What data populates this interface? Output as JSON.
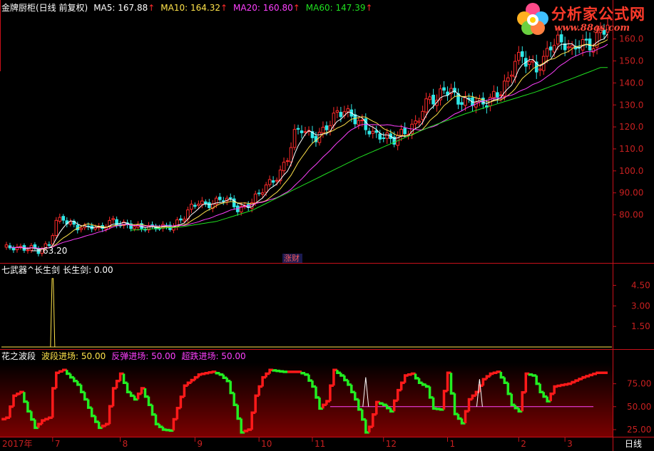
{
  "header1": {
    "title": "金牌厨柜(日线 前复权)",
    "ma5": "MA5: 167.88",
    "ma10": "MA10: 164.32",
    "ma20": "MA20: 160.80",
    "ma60": "MA60: 147.39",
    "arrow": "↑"
  },
  "header2": {
    "title": "七武器^长生剑",
    "value": "长生剑: 0.00"
  },
  "header3": {
    "title": "花之波段",
    "l1": "波段进场: 50.00",
    "l2": "反弹进场: 50.00",
    "l3": "超跌进场: 50.00"
  },
  "logo": {
    "name": "分析家公式网",
    "url": "www.88gs.com"
  },
  "annotations": {
    "low": "63.20",
    "event": "涨财"
  },
  "colors": {
    "up": "#ff2b2b",
    "down": "#2fe8e8",
    "ma5": "#ffffff",
    "ma10": "#ffe34a",
    "ma20": "#ff40ff",
    "ma60": "#20e020",
    "frame": "#c8101a",
    "green_seg": "#22ee22",
    "red_seg": "#ff1a1a",
    "white_line": "#ffffff",
    "magenta_line": "#ff44ff"
  },
  "bottom": {
    "year_label": "2017年",
    "months": [
      "7",
      "8",
      "9",
      "10",
      "11",
      "12",
      "1",
      "2",
      "3"
    ],
    "period": "日线"
  },
  "chart_data": [
    {
      "type": "candlestick",
      "title": "金牌厨柜(日线 前复权)",
      "y_ticks": [
        80.0,
        90.0,
        100.0,
        110.0,
        120.0,
        130.0,
        140.0,
        150.0,
        160.0
      ],
      "y_tick_labels": [
        "80.00",
        "90.00",
        "100.0",
        "110.0",
        "120.0",
        "130.0",
        "140.0",
        "150.0",
        "160.0"
      ],
      "ylim": [
        63,
        168
      ],
      "x_months": [
        "7",
        "8",
        "9",
        "10",
        "11",
        "12",
        "1",
        "2",
        "3"
      ],
      "close_path": [
        [
          0,
          65
        ],
        [
          4,
          64.5
        ],
        [
          8,
          65.5
        ],
        [
          10,
          63.5
        ],
        [
          13,
          66
        ],
        [
          15,
          77
        ],
        [
          17,
          79
        ],
        [
          19,
          76
        ],
        [
          21,
          74
        ],
        [
          23,
          73.5
        ],
        [
          25,
          75
        ],
        [
          27,
          74
        ],
        [
          29,
          76
        ],
        [
          31,
          77
        ],
        [
          33,
          75
        ],
        [
          36,
          75.5
        ],
        [
          39,
          74.5
        ],
        [
          42,
          73.8
        ],
        [
          45,
          74.5
        ],
        [
          48,
          75.5
        ],
        [
          51,
          79
        ],
        [
          53,
          83
        ],
        [
          55,
          86
        ],
        [
          57,
          85
        ],
        [
          60,
          86
        ],
        [
          62,
          87
        ],
        [
          64,
          86
        ],
        [
          66,
          83
        ],
        [
          68,
          84
        ],
        [
          70,
          86
        ],
        [
          72,
          89
        ],
        [
          74,
          93
        ],
        [
          76,
          96
        ],
        [
          78,
          100
        ],
        [
          80,
          106
        ],
        [
          82,
          116
        ],
        [
          84,
          119
        ],
        [
          86,
          117
        ],
        [
          88,
          116
        ],
        [
          90,
          118
        ],
        [
          92,
          121
        ],
        [
          94,
          126
        ],
        [
          96,
          128
        ],
        [
          98,
          126
        ],
        [
          100,
          122
        ],
        [
          102,
          119
        ],
        [
          104,
          116
        ],
        [
          106,
          117
        ],
        [
          108,
          116
        ],
        [
          110,
          114
        ],
        [
          112,
          116
        ],
        [
          114,
          118
        ],
        [
          116,
          122
        ],
        [
          118,
          129
        ],
        [
          120,
          133
        ],
        [
          122,
          131
        ],
        [
          124,
          137
        ],
        [
          126,
          137
        ],
        [
          128,
          133
        ],
        [
          130,
          131
        ],
        [
          132,
          131
        ],
        [
          134,
          130
        ],
        [
          136,
          132
        ],
        [
          138,
          135
        ],
        [
          140,
          136
        ],
        [
          142,
          140
        ],
        [
          144,
          150
        ],
        [
          146,
          153
        ],
        [
          148,
          150
        ],
        [
          150,
          146
        ],
        [
          152,
          149
        ],
        [
          154,
          157
        ],
        [
          156,
          160
        ],
        [
          158,
          159
        ],
        [
          160,
          154
        ],
        [
          162,
          157
        ],
        [
          164,
          157
        ],
        [
          166,
          158
        ],
        [
          168,
          165
        ],
        [
          170,
          166
        ]
      ],
      "ma60_path": [
        [
          36,
          73
        ],
        [
          50,
          74.5
        ],
        [
          60,
          77
        ],
        [
          70,
          82
        ],
        [
          80,
          90
        ],
        [
          90,
          98
        ],
        [
          100,
          106
        ],
        [
          110,
          113
        ],
        [
          120,
          120
        ],
        [
          130,
          126
        ],
        [
          140,
          131
        ],
        [
          150,
          136
        ],
        [
          160,
          142
        ],
        [
          168,
          147
        ]
      ],
      "legend": [
        {
          "name": "MA5",
          "value": 167.88
        },
        {
          "name": "MA10",
          "value": 164.32
        },
        {
          "name": "MA20",
          "value": 160.8
        },
        {
          "name": "MA60",
          "value": 147.39
        }
      ],
      "annotations": [
        "63.20",
        "涨财"
      ]
    },
    {
      "type": "line",
      "title": "七武器^长生剑",
      "y_ticks": [
        1.5,
        3.0,
        4.5
      ],
      "y_tick_labels": [
        "1.50",
        "3.00",
        "4.50"
      ],
      "ylim": [
        0,
        5.2
      ],
      "spikes": [
        {
          "x": 14,
          "value": 5.0
        }
      ]
    },
    {
      "type": "line",
      "title": "花之波段",
      "y_ticks": [
        25.0,
        50.0,
        75.0
      ],
      "y_tick_labels": [
        "25.00",
        "50.00",
        "75.00"
      ],
      "ylim": [
        18,
        98
      ],
      "entry_level": 50,
      "wave_path": [
        [
          0,
          35
        ],
        [
          2,
          38
        ],
        [
          4,
          62
        ],
        [
          6,
          66
        ],
        [
          8,
          45
        ],
        [
          10,
          27
        ],
        [
          12,
          35
        ],
        [
          14,
          38
        ],
        [
          15,
          70
        ],
        [
          16,
          87
        ],
        [
          18,
          90
        ],
        [
          20,
          82
        ],
        [
          22,
          74
        ],
        [
          24,
          58
        ],
        [
          26,
          40
        ],
        [
          28,
          27
        ],
        [
          30,
          31
        ],
        [
          32,
          70
        ],
        [
          34,
          86
        ],
        [
          36,
          66
        ],
        [
          38,
          58
        ],
        [
          40,
          70
        ],
        [
          42,
          52
        ],
        [
          44,
          31
        ],
        [
          46,
          25
        ],
        [
          48,
          24
        ],
        [
          52,
          73
        ],
        [
          56,
          85
        ],
        [
          60,
          88
        ],
        [
          62,
          85
        ],
        [
          64,
          78
        ],
        [
          66,
          52
        ],
        [
          68,
          22
        ],
        [
          70,
          25
        ],
        [
          72,
          62
        ],
        [
          74,
          82
        ],
        [
          76,
          90
        ],
        [
          80,
          88
        ],
        [
          84,
          88
        ],
        [
          86,
          85
        ],
        [
          88,
          72
        ],
        [
          90,
          48
        ],
        [
          92,
          56
        ],
        [
          94,
          90
        ],
        [
          96,
          84
        ],
        [
          98,
          74
        ],
        [
          100,
          58
        ],
        [
          102,
          36
        ],
        [
          103,
          22
        ],
        [
          104,
          28
        ],
        [
          106,
          55
        ],
        [
          108,
          52
        ],
        [
          110,
          45
        ],
        [
          112,
          68
        ],
        [
          114,
          84
        ],
        [
          116,
          86
        ],
        [
          118,
          76
        ],
        [
          120,
          72
        ],
        [
          122,
          48
        ],
        [
          124,
          47
        ],
        [
          126,
          87
        ],
        [
          128,
          42
        ],
        [
          130,
          32
        ],
        [
          132,
          58
        ],
        [
          134,
          66
        ],
        [
          136,
          80
        ],
        [
          138,
          86
        ],
        [
          140,
          88
        ],
        [
          142,
          76
        ],
        [
          144,
          52
        ],
        [
          146,
          45
        ],
        [
          148,
          86
        ],
        [
          150,
          84
        ],
        [
          152,
          66
        ],
        [
          154,
          56
        ],
        [
          156,
          72
        ],
        [
          160,
          75
        ],
        [
          164,
          82
        ],
        [
          168,
          87
        ]
      ]
    }
  ]
}
